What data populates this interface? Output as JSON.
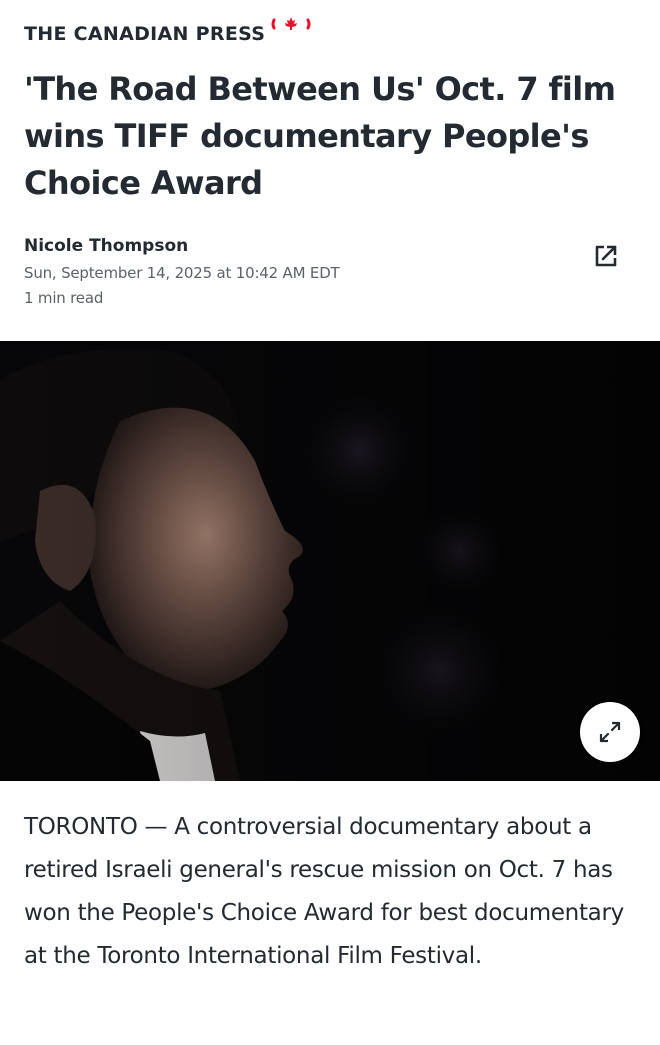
{
  "source": {
    "name": "THE CANADIAN PRESS",
    "icon": "canada-flag-icon"
  },
  "article": {
    "title": "'The Road Between Us' Oct. 7 film wins TIFF documentary People's Choice Award",
    "author": "Nicole Thompson",
    "date": "Sun, September 14, 2025 at 10:42 AM EDT",
    "read_time": "1 min read",
    "paragraph": "TORONTO — A controversial documentary about a retired Israeli general's rescue mission on Oct. 7 has won the People's Choice Award for best documentary at the Toronto International Film Festival."
  },
  "actions": {
    "share_icon": "external-share-icon",
    "expand_icon": "expand-arrows-icon"
  },
  "colors": {
    "text": "#232a31",
    "meta": "#5b636a",
    "flag_red": "#e8112d",
    "photo_bg": "#070709"
  }
}
